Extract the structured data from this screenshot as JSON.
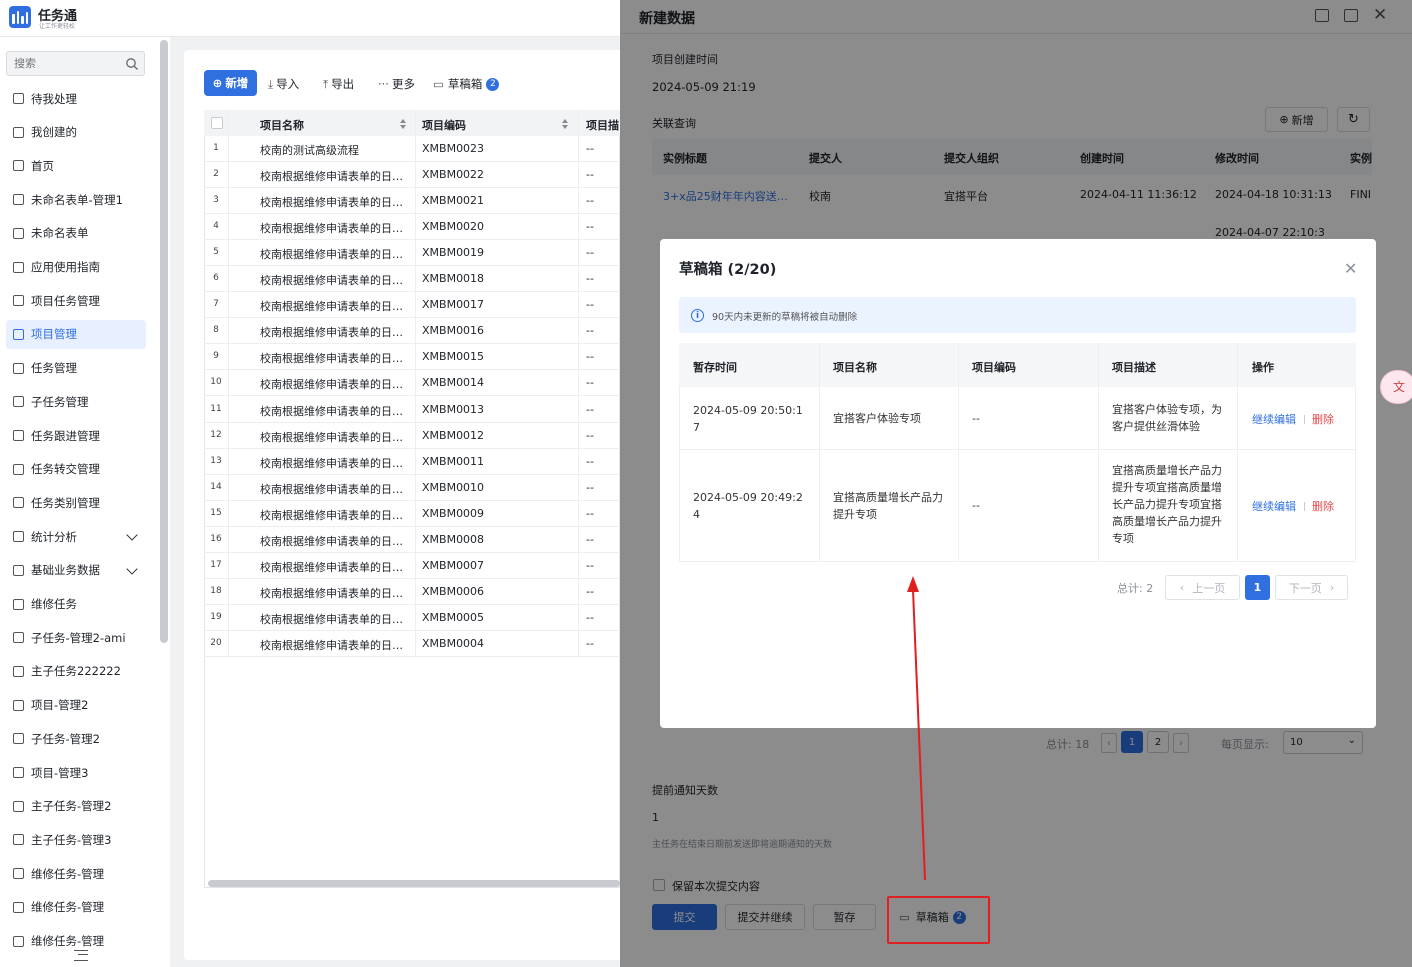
{
  "app": {
    "title": "任务通",
    "subtitle": "让工作更轻松"
  },
  "sidebar": {
    "search_placeholder": "搜索",
    "items": [
      {
        "label": "待我处理"
      },
      {
        "label": "我创建的"
      },
      {
        "label": "首页"
      },
      {
        "label": "未命名表单-管理1"
      },
      {
        "label": "未命名表单"
      },
      {
        "label": "应用使用指南"
      },
      {
        "label": "项目任务管理"
      },
      {
        "label": "项目管理",
        "active": true
      },
      {
        "label": "任务管理"
      },
      {
        "label": "子任务管理"
      },
      {
        "label": "任务跟进管理"
      },
      {
        "label": "任务转交管理"
      },
      {
        "label": "任务类别管理"
      },
      {
        "label": "统计分析",
        "expandable": true
      },
      {
        "label": "基础业务数据",
        "expandable": true
      },
      {
        "label": "维修任务"
      },
      {
        "label": "子任务-管理2-ami"
      },
      {
        "label": "主子任务222222"
      },
      {
        "label": "项目-管理2"
      },
      {
        "label": "子任务-管理2"
      },
      {
        "label": "项目-管理3"
      },
      {
        "label": "主子任务-管理2"
      },
      {
        "label": "主子任务-管理3"
      },
      {
        "label": "维修任务-管理"
      },
      {
        "label": "维修任务-管理"
      },
      {
        "label": "维修任务-管理"
      }
    ]
  },
  "toolbar": {
    "add": "新增",
    "import": "导入",
    "export": "导出",
    "more": "更多",
    "drafts": "草稿箱",
    "drafts_count": "2"
  },
  "grid": {
    "columns": [
      "项目名称",
      "项目编码",
      "项目描"
    ],
    "rows": [
      {
        "no": "1",
        "name": "校南的测试高级流程",
        "code": "XMBM0023",
        "desc": "--"
      },
      {
        "no": "2",
        "name": "校南根据维修申请表单的日…",
        "code": "XMBM0022",
        "desc": "--"
      },
      {
        "no": "3",
        "name": "校南根据维修申请表单的日…",
        "code": "XMBM0021",
        "desc": "--"
      },
      {
        "no": "4",
        "name": "校南根据维修申请表单的日…",
        "code": "XMBM0020",
        "desc": "--"
      },
      {
        "no": "5",
        "name": "校南根据维修申请表单的日…",
        "code": "XMBM0019",
        "desc": "--"
      },
      {
        "no": "6",
        "name": "校南根据维修申请表单的日…",
        "code": "XMBM0018",
        "desc": "--"
      },
      {
        "no": "7",
        "name": "校南根据维修申请表单的日…",
        "code": "XMBM0017",
        "desc": "--"
      },
      {
        "no": "8",
        "name": "校南根据维修申请表单的日…",
        "code": "XMBM0016",
        "desc": "--"
      },
      {
        "no": "9",
        "name": "校南根据维修申请表单的日…",
        "code": "XMBM0015",
        "desc": "--"
      },
      {
        "no": "10",
        "name": "校南根据维修申请表单的日…",
        "code": "XMBM0014",
        "desc": "--"
      },
      {
        "no": "11",
        "name": "校南根据维修申请表单的日…",
        "code": "XMBM0013",
        "desc": "--"
      },
      {
        "no": "12",
        "name": "校南根据维修申请表单的日…",
        "code": "XMBM0012",
        "desc": "--"
      },
      {
        "no": "13",
        "name": "校南根据维修申请表单的日…",
        "code": "XMBM0011",
        "desc": "--"
      },
      {
        "no": "14",
        "name": "校南根据维修申请表单的日…",
        "code": "XMBM0010",
        "desc": "--"
      },
      {
        "no": "15",
        "name": "校南根据维修申请表单的日…",
        "code": "XMBM0009",
        "desc": "--"
      },
      {
        "no": "16",
        "name": "校南根据维修申请表单的日…",
        "code": "XMBM0008",
        "desc": "--"
      },
      {
        "no": "17",
        "name": "校南根据维修申请表单的日…",
        "code": "XMBM0007",
        "desc": "--"
      },
      {
        "no": "18",
        "name": "校南根据维修申请表单的日…",
        "code": "XMBM0006",
        "desc": "--"
      },
      {
        "no": "19",
        "name": "校南根据维修申请表单的日…",
        "code": "XMBM0005",
        "desc": "--"
      },
      {
        "no": "20",
        "name": "校南根据维修申请表单的日…",
        "code": "XMBM0004",
        "desc": "--"
      }
    ]
  },
  "drawer": {
    "title": "新建数据",
    "created_label": "项目创建时间",
    "created_value": "2024-05-09 21:19",
    "assoc_label": "关联查询",
    "assoc_add": "新增",
    "assoc_columns": [
      "实例标题",
      "提交人",
      "提交人组织",
      "创建时间",
      "修改时间",
      "实例"
    ],
    "assoc_row": {
      "title": "3+x品25财年年内容送…",
      "submitter": "校南",
      "org": "宜搭平台",
      "created": "2024-04-11 11:36:12",
      "modified": "2024-04-18 10:31:13",
      "status": "FINI"
    },
    "assoc_row2_modified": "2024-04-07 22:10:3",
    "assoc_total": "总计: 18",
    "assoc_pages": [
      "1",
      "2"
    ],
    "page_size_label": "每页显示:",
    "page_size_value": "10",
    "remind_label": "提前通知天数",
    "remind_value": "1",
    "remind_hint": "主任务在结束日期前发送即将逾期通知的天数",
    "keep_label": "保留本次提交内容",
    "submit": "提交",
    "submit_continue": "提交并继续",
    "save_draft": "暂存",
    "drafts": "草稿箱",
    "drafts_count": "2"
  },
  "modal": {
    "title": "草稿箱 (2/20)",
    "notice": "90天内未更新的草稿将被自动删除",
    "columns": [
      "暂存时间",
      "项目名称",
      "项目编码",
      "项目描述",
      "操作"
    ],
    "rows": [
      {
        "time": "2024-05-09 20:50:17",
        "name": "宜搭客户体验专项",
        "code": "--",
        "desc": "宜搭客户体验专项，为客户提供丝滑体验",
        "edit": "继续编辑",
        "delete": "删除"
      },
      {
        "time": "2024-05-09 20:49:24",
        "name": "宜搭高质量增长产品力提升专项",
        "code": "--",
        "desc": "宜搭高质量增长产品力提升专项宜搭高质量增长产品力提升专项宜搭高质量增长产品力提升专项",
        "edit": "继续编辑",
        "delete": "删除"
      }
    ],
    "total": "总计: 2",
    "prev": "上一页",
    "next": "下一页",
    "current_page": "1"
  },
  "colors": {
    "primary": "#2f6fe0",
    "danger": "#e5484d",
    "annotation": "#e02020"
  }
}
